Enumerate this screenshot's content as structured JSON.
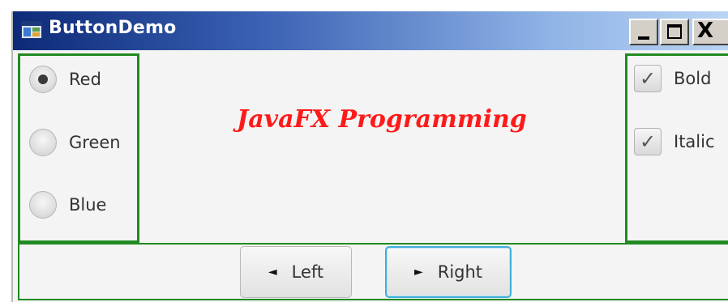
{
  "window": {
    "title": "ButtonDemo",
    "controls": {
      "minimize": "_",
      "maximize": "□",
      "close": "X"
    }
  },
  "color_options": [
    {
      "label": "Red",
      "selected": true
    },
    {
      "label": "Green",
      "selected": false
    },
    {
      "label": "Blue",
      "selected": false
    }
  ],
  "display": {
    "text": "JavaFX Programming",
    "color": "#ff1a1a"
  },
  "style_options": [
    {
      "label": "Bold",
      "checked": true
    },
    {
      "label": "Italic",
      "checked": true
    }
  ],
  "buttons": {
    "left": {
      "label": "Left",
      "icon": "arrow-left-icon"
    },
    "right": {
      "label": "Right",
      "icon": "arrow-right-icon"
    }
  },
  "colors": {
    "pane_border": "#218a21",
    "focus_ring": "#3fb0dc"
  }
}
